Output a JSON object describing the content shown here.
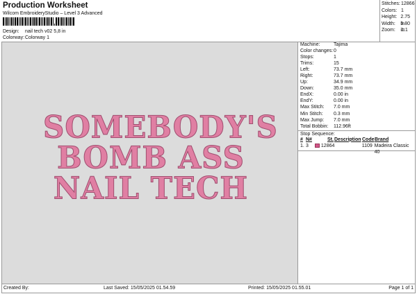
{
  "header": {
    "title": "Production Worksheet",
    "software": "Wilcom EmbroideryStudio – Level 3 Advanced",
    "design_label": "Design:",
    "design_value": "nail tech v02 5,8 in",
    "colorway_label": "Colorway:",
    "colorway_value": "Colorway 1"
  },
  "stats": [
    {
      "k": "Stitches:",
      "v": "12866"
    },
    {
      "k": "Colors:",
      "v": "1"
    },
    {
      "k": "Height:",
      "v": "2.75 in"
    },
    {
      "k": "Width:",
      "v": "5.80 in"
    },
    {
      "k": "Zoom:",
      "v": "1:1"
    }
  ],
  "machine": [
    {
      "k": "Machine:",
      "v": "Tajima"
    },
    {
      "k": "Color changes:",
      "v": "0"
    },
    {
      "k": "Stops:",
      "v": "1"
    },
    {
      "k": "Trims:",
      "v": "15"
    },
    {
      "k": "Left:",
      "v": "73.7 mm"
    },
    {
      "k": "Right:",
      "v": "73.7 mm"
    },
    {
      "k": "Up:",
      "v": "34.9 mm"
    },
    {
      "k": "Down:",
      "v": "35.0 mm"
    },
    {
      "k": "EndX:",
      "v": "0.00 in"
    },
    {
      "k": "EndY:",
      "v": "0.00 in"
    },
    {
      "k": "Max Stitch:",
      "v": "7.0 mm"
    },
    {
      "k": "Min Stitch:",
      "v": "0.3 mm"
    },
    {
      "k": "Max Jump:",
      "v": "7.0 mm"
    },
    {
      "k": "Total Bobbin:",
      "v": "112.96ft"
    }
  ],
  "stop_sequence": {
    "title": "Stop Sequence:",
    "headers": [
      "#",
      "N#",
      "St.",
      "Description",
      "Code",
      "Brand"
    ],
    "rows": [
      {
        "num": "1.",
        "n": "3",
        "swatch": "#d0578a",
        "st": "12864",
        "desc": "",
        "code": "1109",
        "brand": "Madeira Classic 40"
      }
    ]
  },
  "design_artwork": {
    "lines": [
      "SOMEBODY'S",
      "BOMB ASS",
      "NAIL TECH"
    ],
    "thread_color": "#e07fa3"
  },
  "footer": {
    "created": "Created By:",
    "saved": "Last Saved: 15/05/2025 01.54.59",
    "printed": "Printed: 15/05/2025 01.55.01",
    "page": "Page 1 of 1"
  }
}
